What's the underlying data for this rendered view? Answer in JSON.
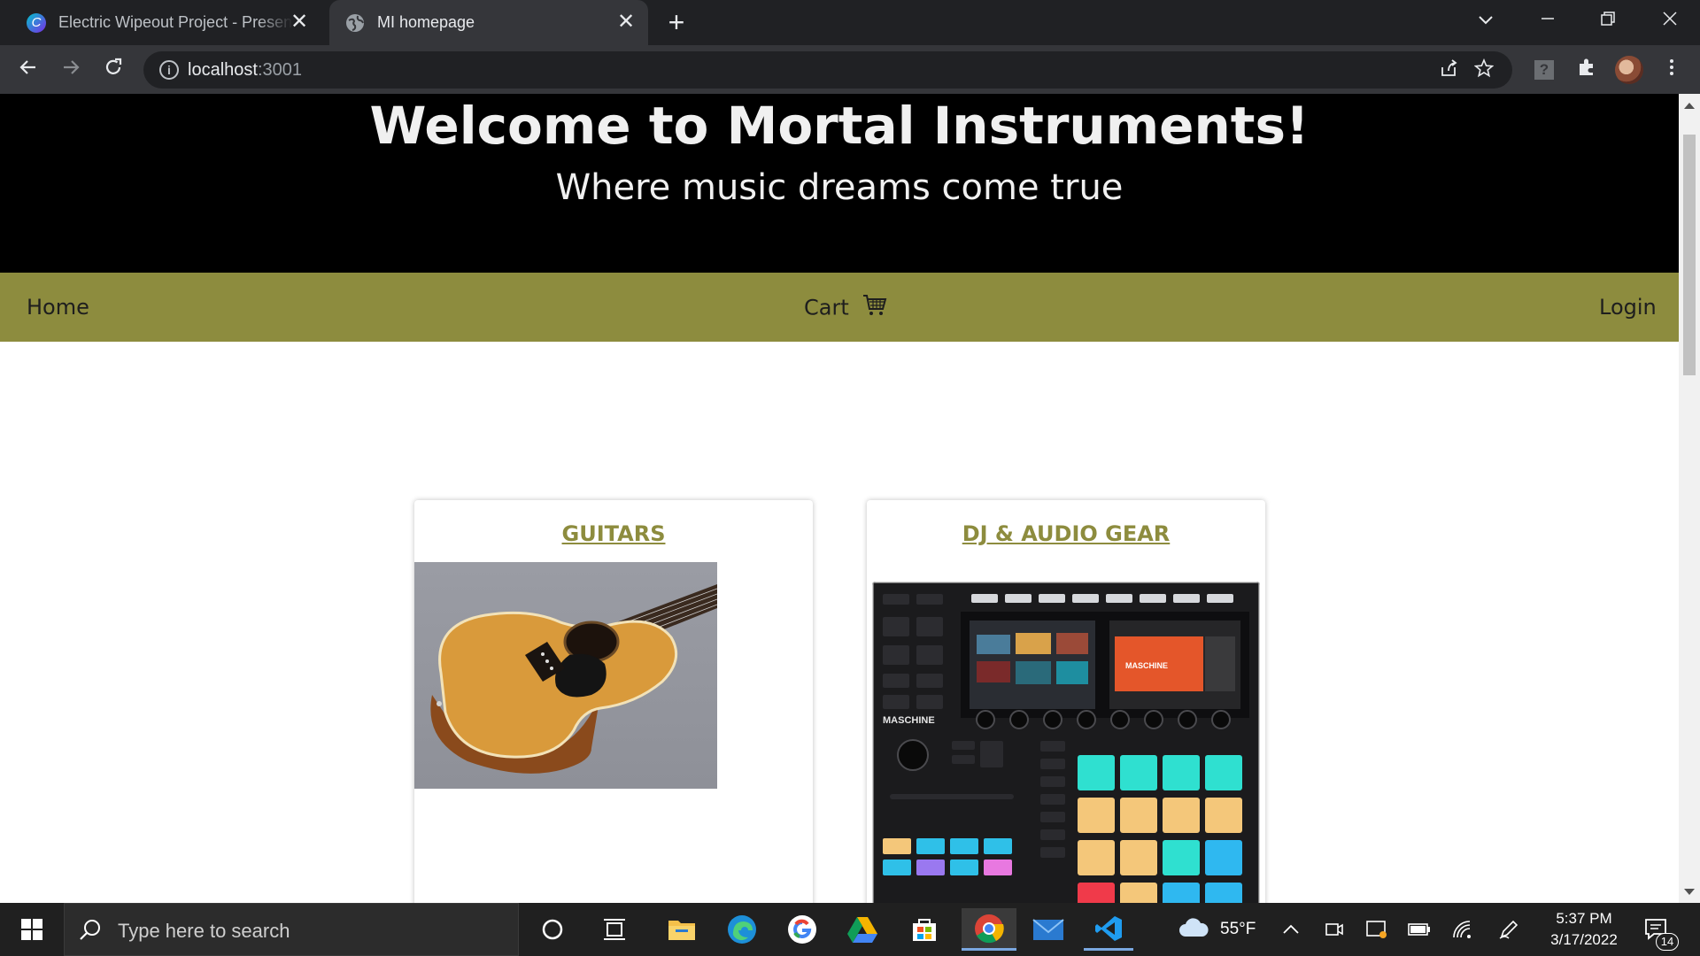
{
  "browser": {
    "tabs": [
      {
        "title": "Electric Wipeout Project - Presen"
      },
      {
        "title": "MI homepage"
      }
    ],
    "url_host": "localhost",
    "url_port": ":3001"
  },
  "page": {
    "hero_title": "Welcome to Mortal Instruments!",
    "hero_subtitle": "Where music dreams come true",
    "nav": {
      "home": "Home",
      "cart": "Cart",
      "login": "Login"
    },
    "categories": [
      {
        "title": "GUITARS",
        "image": "acoustic-guitar-photo"
      },
      {
        "title": "DJ & AUDIO GEAR",
        "image": "maschine-controller-photo",
        "device_label": "MASCHINE"
      }
    ]
  },
  "taskbar": {
    "search_placeholder": "Type here to search",
    "weather": "55°F",
    "time": "5:37 PM",
    "date": "3/17/2022",
    "notifications": "14"
  },
  "colors": {
    "nav_bg": "#8d8c3e",
    "hero_bg": "#000000",
    "card_title": "#8d8c3e"
  }
}
